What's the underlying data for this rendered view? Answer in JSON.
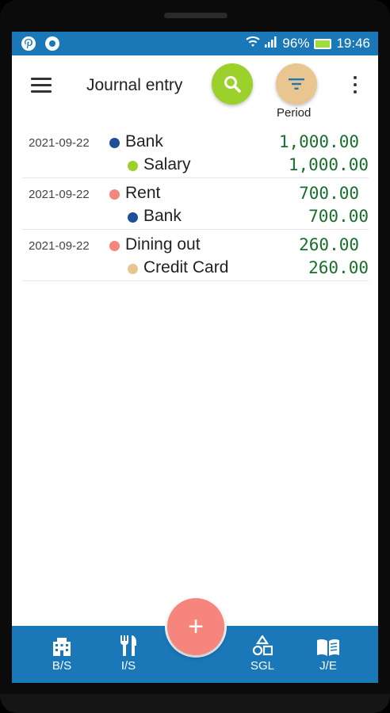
{
  "status_bar": {
    "battery": "96%",
    "time": "19:46"
  },
  "app_bar": {
    "title": "Journal entry",
    "period_label": "Period"
  },
  "entries": [
    {
      "date": "2021-09-22",
      "debit_account": "Bank",
      "debit_color": "#1e4f9a",
      "debit_amount": "1,000.00",
      "credit_account": "Salary",
      "credit_color": "#9bd12a",
      "credit_amount": "1,000.00"
    },
    {
      "date": "2021-09-22",
      "debit_account": "Rent",
      "debit_color": "#f6857d",
      "debit_amount": "700.00",
      "credit_account": "Bank",
      "credit_color": "#1e4f9a",
      "credit_amount": "700.00"
    },
    {
      "date": "2021-09-22",
      "debit_account": "Dining out",
      "debit_color": "#f6857d",
      "debit_amount": "260.00",
      "credit_account": "Credit Card",
      "credit_color": "#e9c58f",
      "credit_amount": "260.00"
    }
  ],
  "bottom_nav": [
    {
      "label": "B/S",
      "icon": "building-icon"
    },
    {
      "label": "I/S",
      "icon": "fork-knife-icon"
    },
    {
      "label": "SGL",
      "icon": "shapes-icon"
    },
    {
      "label": "J/E",
      "icon": "book-icon"
    }
  ],
  "fab": {
    "label": "+"
  },
  "colors": {
    "primary": "#1a77b8",
    "search": "#9bd12a",
    "period": "#e9c58f",
    "fab": "#f6857d",
    "amount": "#176f2b"
  }
}
